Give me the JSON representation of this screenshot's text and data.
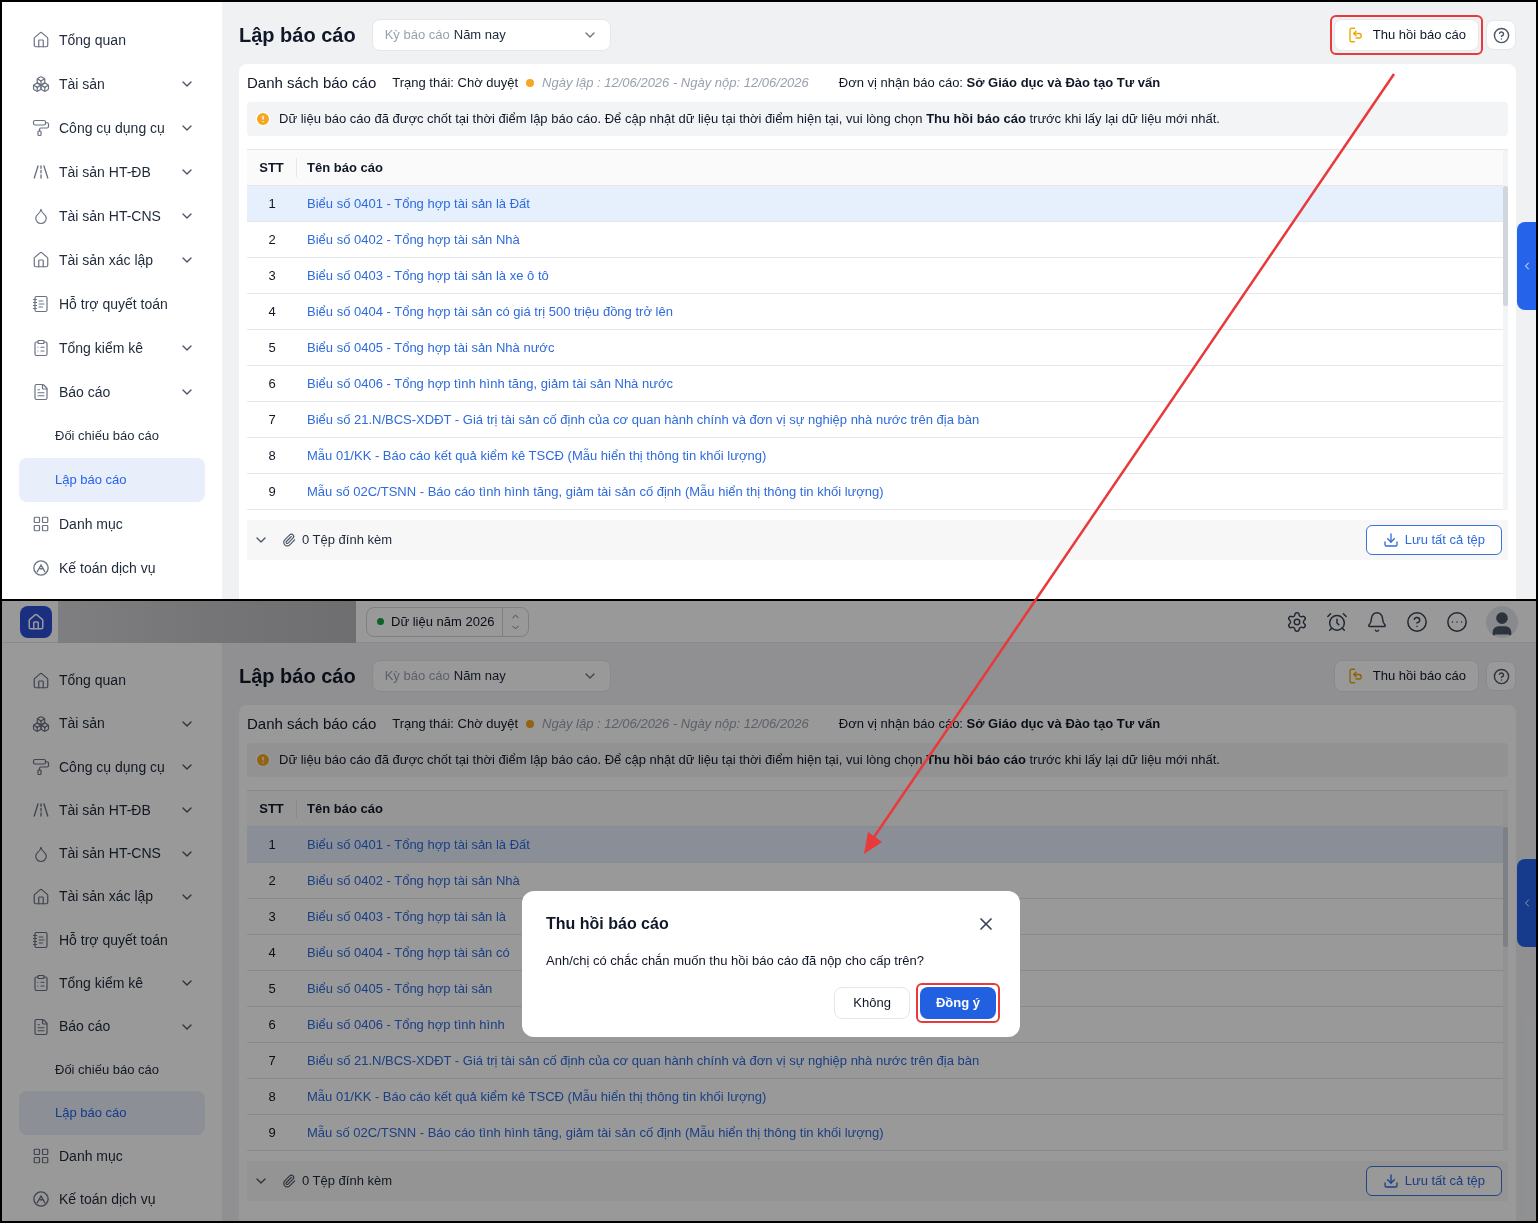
{
  "screens": [
    {
      "sidebar": {
        "items": [
          {
            "label": "Tổng quan",
            "has_submenu": false,
            "selected": false
          },
          {
            "label": "Tài sản",
            "has_submenu": true,
            "selected": false
          },
          {
            "label": "Công cụ dụng cụ",
            "has_submenu": true,
            "selected": false
          },
          {
            "label": "Tài sản HT-ĐB",
            "has_submenu": true,
            "selected": false
          },
          {
            "label": "Tài sản HT-CNS",
            "has_submenu": true,
            "selected": false
          },
          {
            "label": "Tài sản xác lập",
            "has_submenu": true,
            "selected": false
          },
          {
            "label": "Hỗ trợ quyết toán",
            "has_submenu": false,
            "selected": false
          },
          {
            "label": "Tổng kiểm kê",
            "has_submenu": true,
            "selected": false
          },
          {
            "label": "Báo cáo",
            "has_submenu": true,
            "selected": false,
            "children": [
              {
                "label": "Đối chiếu báo cáo",
                "selected": false
              },
              {
                "label": "Lập báo cáo",
                "selected": true
              }
            ]
          },
          {
            "label": "Danh mục",
            "has_submenu": false,
            "selected": false
          },
          {
            "label": "Kế toán dịch vụ",
            "has_submenu": false,
            "selected": false
          }
        ]
      },
      "page": {
        "title": "Lập báo cáo",
        "period_select": {
          "label": "Kỳ báo cáo",
          "value": "Năm nay"
        },
        "recall_button": {
          "label": "Thu hồi báo cáo",
          "highlighted": true
        }
      },
      "list": {
        "title": "Danh sách báo cáo",
        "status": "Trạng thái: Chờ duyệt",
        "dates": "Ngày lập : 12/06/2026 - Ngày nộp: 12/06/2026",
        "recipient": "Đơn vị nhận báo cáo: **Sở Giáo dục và Đào tạo Tư vấn**"
      },
      "notice": "Dữ liệu báo cáo đã được chốt tại thời điểm lập báo cáo. Để cập nhật dữ liệu tại thời điểm hiện tại, vui lòng chọn **Thu hồi báo cáo** trước khi lấy lại dữ liệu mới nhất.",
      "table": {
        "columns": [
          "STT",
          "Tên báo cáo"
        ],
        "rows": [
          {
            "stt": "1",
            "name": "Biểu số 0401 - Tổng hợp tài sản là Đất",
            "selected": true
          },
          {
            "stt": "2",
            "name": "Biểu số 0402 - Tổng hợp tài sản Nhà",
            "selected": false
          },
          {
            "stt": "3",
            "name": "Biểu số 0403 - Tổng hợp tài sản là xe ô tô",
            "selected": false
          },
          {
            "stt": "4",
            "name": "Biểu số 0404 - Tổng hợp tài sản có giá trị 500 triệu đồng trở lên",
            "selected": false
          },
          {
            "stt": "5",
            "name": "Biểu số 0405 - Tổng hợp tài sản Nhà nước",
            "selected": false
          },
          {
            "stt": "6",
            "name": "Biểu số 0406 - Tổng hợp tình hình tăng, giảm tài sản Nhà nước",
            "selected": false
          },
          {
            "stt": "7",
            "name": "Biểu số 21.N/BCS-XDĐT - Giá trị tài sản cố định của cơ quan hành chính và đơn vị sự nghiệp nhà nước trên địa bàn",
            "selected": false
          },
          {
            "stt": "8",
            "name": "Mẫu 01/KK - Báo cáo kết quả kiểm kê TSCĐ (Mẫu hiển thị thông tin khối lượng)",
            "selected": false
          },
          {
            "stt": "9",
            "name": "Mẫu số 02C/TSNN - Báo cáo tình hình tăng, giảm tài sản cố định (Mẫu hiển thị thông tin khối lượng)",
            "selected": false
          }
        ]
      },
      "attachments": {
        "label": "0 Tệp đính kèm",
        "save_all": "Lưu tất cả tệp"
      }
    },
    {
      "top_bar": {
        "year_selector": "Dữ liệu năm 2026"
      },
      "sidebar": {
        "items": [
          {
            "label": "Tổng quan",
            "has_submenu": false,
            "selected": false
          },
          {
            "label": "Tài sản",
            "has_submenu": true,
            "selected": false
          },
          {
            "label": "Công cụ dụng cụ",
            "has_submenu": true,
            "selected": false
          },
          {
            "label": "Tài sản HT-ĐB",
            "has_submenu": true,
            "selected": false
          },
          {
            "label": "Tài sản HT-CNS",
            "has_submenu": true,
            "selected": false
          },
          {
            "label": "Tài sản xác lập",
            "has_submenu": true,
            "selected": false
          },
          {
            "label": "Hỗ trợ quyết toán",
            "has_submenu": false,
            "selected": false
          },
          {
            "label": "Tổng kiểm kê",
            "has_submenu": true,
            "selected": false
          },
          {
            "label": "Báo cáo",
            "has_submenu": true,
            "selected": false,
            "children": [
              {
                "label": "Đối chiếu báo cáo",
                "selected": false
              },
              {
                "label": "Lập báo cáo",
                "selected": true
              }
            ]
          },
          {
            "label": "Danh mục",
            "has_submenu": false,
            "selected": false
          },
          {
            "label": "Kế toán dịch vụ",
            "has_submenu": false,
            "selected": false
          }
        ]
      },
      "page": {
        "title": "Lập báo cáo",
        "period_select": {
          "label": "Kỳ báo cáo",
          "value": "Năm nay"
        },
        "recall_button": {
          "label": "Thu hồi báo cáo",
          "highlighted": false
        }
      },
      "list": {
        "title": "Danh sách báo cáo",
        "status": "Trạng thái: Chờ duyệt",
        "dates": "Ngày lập : 12/06/2026 - Ngày nộp: 12/06/2026",
        "recipient": "Đơn vị nhận báo cáo: **Sở Giáo dục và Đào tạo Tư vấn**"
      },
      "notice": "Dữ liệu báo cáo đã được chốt tại thời điểm lập báo cáo. Để cập nhật dữ liệu tại thời điểm hiện tại, vui lòng chọn **Thu hồi báo cáo** trước khi lấy lại dữ liệu mới nhất.",
      "table": {
        "columns": [
          "STT",
          "Tên báo cáo"
        ],
        "rows": [
          {
            "stt": "1",
            "name": "Biểu số 0401 - Tổng hợp tài sản là Đất",
            "selected": true
          },
          {
            "stt": "2",
            "name": "Biểu số 0402 - Tổng hợp tài sản Nhà",
            "selected": false
          },
          {
            "stt": "3",
            "name": "Biểu số 0403 - Tổng hợp tài sản là",
            "selected": false
          },
          {
            "stt": "4",
            "name": "Biểu số 0404 - Tổng hợp tài sản có",
            "selected": false
          },
          {
            "stt": "5",
            "name": "Biểu số 0405 - Tổng hợp tài sản",
            "selected": false
          },
          {
            "stt": "6",
            "name": "Biểu số 0406 - Tổng hợp tình hình",
            "selected": false
          },
          {
            "stt": "7",
            "name": "Biểu số 21.N/BCS-XDĐT - Giá trị tài sản cố định của cơ quan hành chính và đơn vị sự nghiệp nhà nước trên địa bàn",
            "selected": false
          },
          {
            "stt": "8",
            "name": "Mẫu 01/KK - Báo cáo kết quả kiểm kê TSCĐ (Mẫu hiển thị thông tin khối lượng)",
            "selected": false
          },
          {
            "stt": "9",
            "name": "Mẫu số 02C/TSNN - Báo cáo tình hình tăng, giảm tài sản cố định (Mẫu hiển thị thông tin khối lượng)",
            "selected": false
          }
        ]
      },
      "attachments": {
        "label": "0 Tệp đính kèm",
        "save_all": "Lưu tất cả tệp"
      },
      "dialog": {
        "title": "Thu hồi báo cáo",
        "message": "Anh/chị có chắc chắn muốn thu hồi báo cáo đã nộp cho cấp trên?",
        "cancel": {
          "label": "Không",
          "highlighted": false
        },
        "confirm": {
          "label": "Đồng ý",
          "highlighted": true
        }
      }
    }
  ]
}
